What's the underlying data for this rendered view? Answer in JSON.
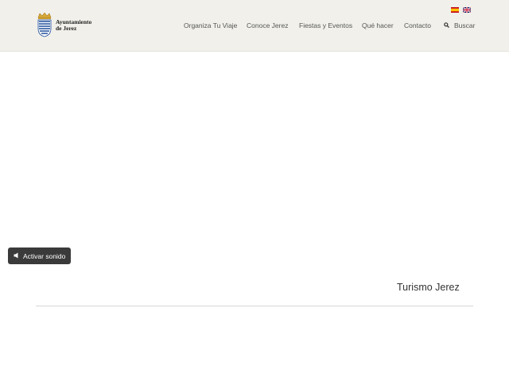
{
  "logo": {
    "line1": "Ayuntamiento",
    "line2": "de Jerez"
  },
  "languages": [
    {
      "code": "es",
      "icon": "spain-flag-icon"
    },
    {
      "code": "en",
      "icon": "uk-flag-icon"
    }
  ],
  "nav": {
    "items": [
      {
        "label": "Organiza Tu Viaje"
      },
      {
        "label": "Conoce Jerez"
      },
      {
        "label": "Fiestas y Eventos"
      },
      {
        "label": "Qué hacer"
      },
      {
        "label": "Contacto"
      }
    ],
    "search_label": "Buscar"
  },
  "video": {
    "sound_button": "Activar sonido"
  },
  "main": {
    "title": "Turismo Jerez"
  },
  "colors": {
    "header_bg": "#f1f0ea",
    "button_bg": "#3a3a3a",
    "nav_text": "#555555"
  }
}
